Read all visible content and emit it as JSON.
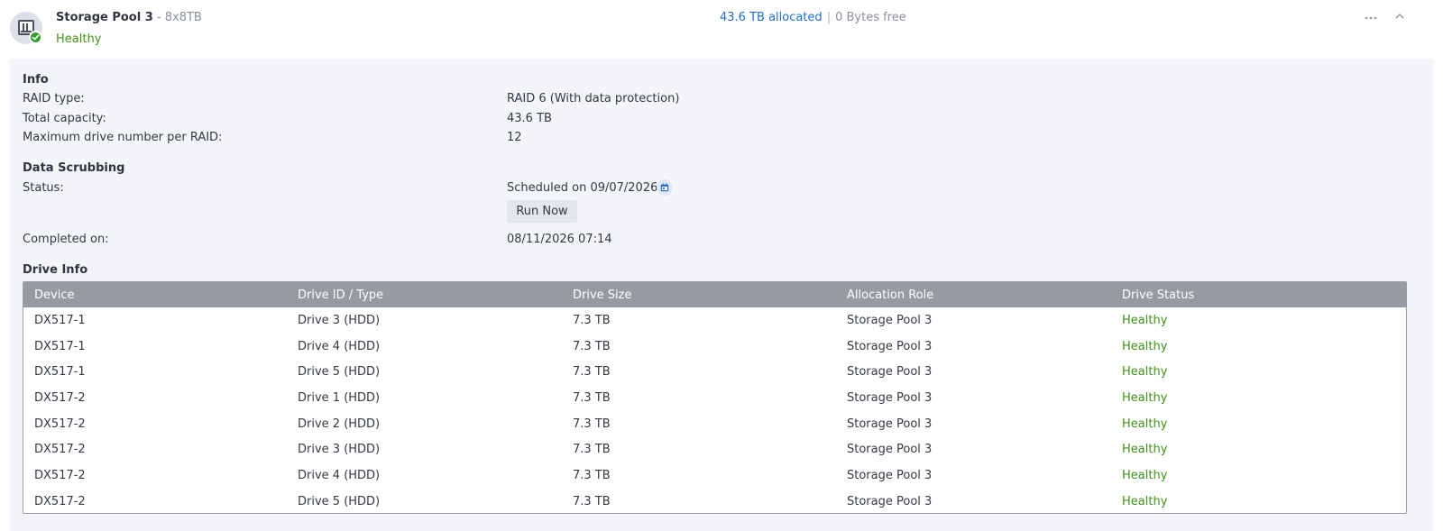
{
  "pool": {
    "name": "Storage Pool 3",
    "separator": "-",
    "spec": "8x8TB",
    "status": "Healthy",
    "allocated": "43.6 TB allocated",
    "divider": "|",
    "free": "0 Bytes free",
    "more_icon": "ellipsis-icon",
    "collapse_icon": "chevron-up-icon"
  },
  "info": {
    "title": "Info",
    "raid_type_label": "RAID type:",
    "raid_type_value": "RAID 6 (With data protection)",
    "capacity_label": "Total capacity:",
    "capacity_value": "43.6 TB",
    "max_drive_label": "Maximum drive number per RAID:",
    "max_drive_value": "12"
  },
  "scrubbing": {
    "title": "Data Scrubbing",
    "status_label": "Status:",
    "status_value": "Scheduled on 09/07/2026",
    "run_now": "Run Now",
    "completed_label": "Completed on:",
    "completed_value": "08/11/2026 07:14"
  },
  "drives": {
    "title": "Drive Info",
    "headers": [
      "Device",
      "Drive ID / Type",
      "Drive Size",
      "Allocation Role",
      "Drive Status"
    ],
    "rows": [
      [
        "DX517-1",
        "Drive 3 (HDD)",
        "7.3 TB",
        "Storage Pool 3",
        "Healthy"
      ],
      [
        "DX517-1",
        "Drive 4 (HDD)",
        "7.3 TB",
        "Storage Pool 3",
        "Healthy"
      ],
      [
        "DX517-1",
        "Drive 5 (HDD)",
        "7.3 TB",
        "Storage Pool 3",
        "Healthy"
      ],
      [
        "DX517-2",
        "Drive 1 (HDD)",
        "7.3 TB",
        "Storage Pool 3",
        "Healthy"
      ],
      [
        "DX517-2",
        "Drive 2 (HDD)",
        "7.3 TB",
        "Storage Pool 3",
        "Healthy"
      ],
      [
        "DX517-2",
        "Drive 3 (HDD)",
        "7.3 TB",
        "Storage Pool 3",
        "Healthy"
      ],
      [
        "DX517-2",
        "Drive 4 (HDD)",
        "7.3 TB",
        "Storage Pool 3",
        "Healthy"
      ],
      [
        "DX517-2",
        "Drive 5 (HDD)",
        "7.3 TB",
        "Storage Pool 3",
        "Healthy"
      ]
    ]
  },
  "colors": {
    "healthy": "#3f9318",
    "allocated": "#1d6fd6",
    "table_header": "#969aa1",
    "panel_bg": "#f3f5f9"
  }
}
